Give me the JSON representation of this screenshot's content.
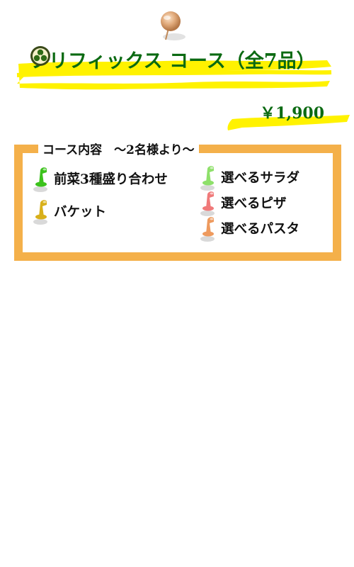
{
  "title": "プリフィックス コース（全7品）",
  "price": "￥1,900",
  "course": {
    "caption": "コース内容　～2名様より～",
    "left_items": [
      {
        "label": "前菜3種盛り合わせ",
        "pin_color": "#3cc21c",
        "icon": "pushpin-icon"
      },
      {
        "label": "バケット",
        "pin_color": "#d8b01a",
        "icon": "pushpin-icon"
      }
    ],
    "right_items": [
      {
        "label": "選べるサラダ",
        "pin_color": "#8ee06a",
        "icon": "pushpin-icon"
      },
      {
        "label": "選べるピザ",
        "pin_color": "#f07a7a",
        "icon": "pushpin-icon"
      },
      {
        "label": "選べるパスタ",
        "pin_color": "#ee9a5e",
        "icon": "pushpin-icon"
      }
    ]
  },
  "colors": {
    "title_text": "#0b6a12",
    "highlight": "#fff200",
    "box_border": "#f4b04a"
  }
}
